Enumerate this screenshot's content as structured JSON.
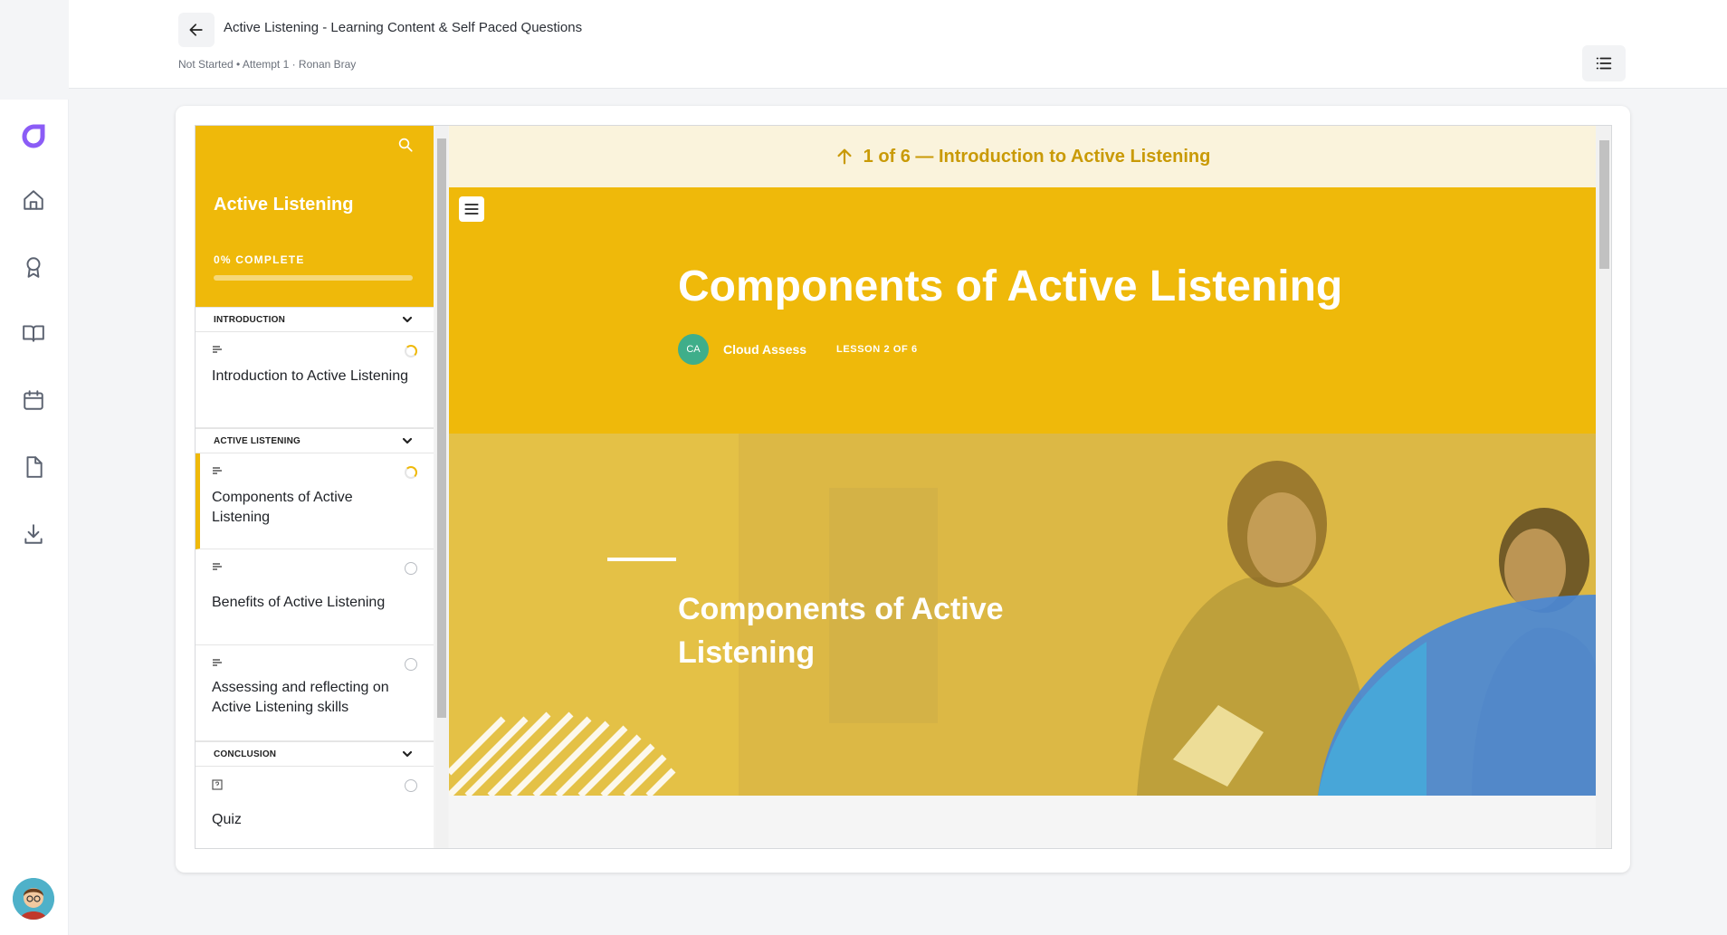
{
  "header": {
    "title": "Active Listening - Learning Content & Self Paced Questions",
    "meta": "Not Started • Attempt 1 · Ronan Bray",
    "back_icon": "arrow-left-icon",
    "outline_icon": "list-icon"
  },
  "rail": {
    "items": [
      {
        "name": "home",
        "icon": "home-icon"
      },
      {
        "name": "awards",
        "icon": "award-icon"
      },
      {
        "name": "library",
        "icon": "book-icon"
      },
      {
        "name": "calendar",
        "icon": "calendar-icon"
      },
      {
        "name": "documents",
        "icon": "file-icon"
      },
      {
        "name": "downloads",
        "icon": "download-icon"
      }
    ]
  },
  "course": {
    "title": "Active Listening",
    "progress_label": "0% COMPLETE",
    "progress_percent": 0,
    "sections": [
      {
        "label": "INTRODUCTION"
      },
      {
        "label": "ACTIVE LISTENING"
      },
      {
        "label": "CONCLUSION"
      }
    ],
    "lessons": [
      {
        "text": "Introduction to Active Listening",
        "status": "partial"
      },
      {
        "text": "Components of Active Listening",
        "status": "partial",
        "active": true
      },
      {
        "text": "Benefits of Active Listening",
        "status": "none"
      },
      {
        "text": "Assessing and reflecting on Active Listening skills",
        "status": "none"
      },
      {
        "text": "Quiz",
        "status": "none"
      }
    ]
  },
  "content": {
    "prev_lesson": "1 of 6 — Introduction to Active Listening",
    "hero_title": "Components of Active Listening",
    "author_initials": "CA",
    "author_name": "Cloud Assess",
    "lesson_count": "LESSON 2 OF 6",
    "banner_title": "Components of Active Listening"
  },
  "colors": {
    "accent": "#efb90a",
    "prev_bar_bg": "#faf3dc",
    "prev_bar_text": "#c99a06",
    "author_badge": "#3fae8a"
  }
}
